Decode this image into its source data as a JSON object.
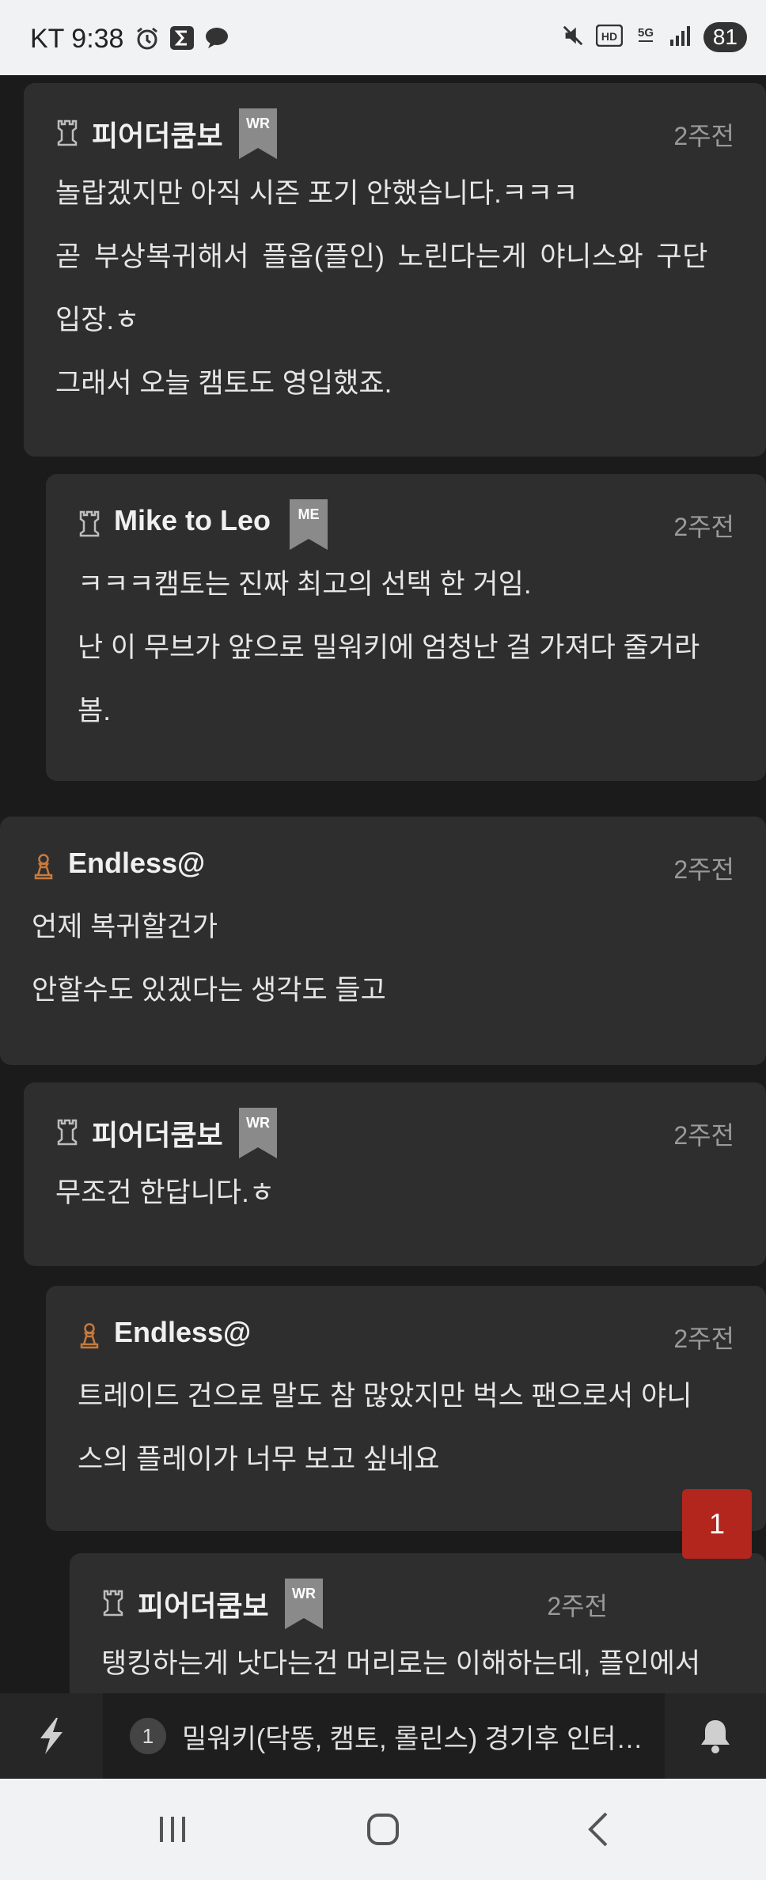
{
  "status_bar": {
    "carrier_time": "KT 9:38",
    "network": "5G",
    "battery": "81",
    "icons": [
      "alarm-icon",
      "sigma-icon",
      "chat-bubble-icon",
      "mute-icon",
      "hd-icon",
      "5g-icon",
      "signal-icon",
      "battery-icon"
    ]
  },
  "comments": [
    {
      "author": "피어더쿰보",
      "badge": "WR",
      "time": "2주전",
      "rank_icon": "chess-rook-icon",
      "lines": [
        "놀랍겠지만 아직 시즌 포기 안했습니다.ㅋㅋㅋ",
        "곧 부상복귀해서 플옵(플인) 노린다는게 야니스와 구단",
        "입장.ㅎ",
        "그래서 오늘 캠토도 영입했죠."
      ]
    },
    {
      "author": "Mike to Leo",
      "badge": "ME",
      "time": "2주전",
      "rank_icon": "chess-rook-icon",
      "lines": [
        "ㅋㅋㅋ캠토는 진짜 최고의 선택 한 거임.",
        "난 이 무브가 앞으로 밀워키에 엄청난 걸 가져다 줄거라",
        "봄."
      ]
    },
    {
      "author": "Endless@",
      "time": "2주전",
      "rank_icon": "chess-pawn-icon",
      "lines": [
        "언제 복귀할건가",
        "안할수도 있겠다는 생각도 들고"
      ]
    },
    {
      "author": "피어더쿰보",
      "badge": "WR",
      "time": "2주전",
      "rank_icon": "chess-rook-icon",
      "lines": [
        "무조건 한답니다.ㅎ"
      ]
    },
    {
      "author": "Endless@",
      "time": "2주전",
      "rank_icon": "chess-pawn-icon",
      "lines": [
        "트레이드 건으로 말도 참 많았지만 벅스 팬으로서 야니",
        "스의 플레이가 너무 보고 싶네요"
      ]
    },
    {
      "author": "피어더쿰보",
      "badge": "WR",
      "time": "2주전",
      "rank_icon": "chess-rook-icon",
      "lines": [
        "탱킹하는게 낫다는건 머리로는 이해하는데, 플인에서"
      ]
    }
  ],
  "notification_count": "1",
  "bottom_bar": {
    "banner_number": "1",
    "banner_text": "밀워키(닥똥, 캠토, 롤린스) 경기후 인터뷰...",
    "left_icon": "lightning-icon",
    "right_icon": "bell-icon"
  },
  "nav_bar": {
    "icons": [
      "recent-apps-icon",
      "home-icon",
      "back-icon"
    ]
  },
  "colors": {
    "card_bg": "#2e2e2e",
    "page_bg": "#1b1b1b",
    "badge_gray": "#8a8a8a",
    "pawn_orange": "#c87a3c",
    "notif_red": "#b3261e"
  }
}
